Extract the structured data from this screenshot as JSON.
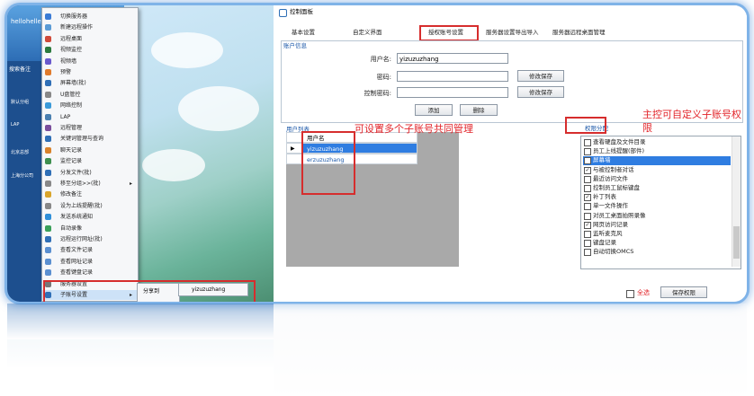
{
  "window": {
    "title": "控制面板"
  },
  "tabs": [
    "基本设置",
    "自定义界面",
    "授权账号设置",
    "服务器设置导出导入",
    "服务器远程桌面管理"
  ],
  "account_info": {
    "section_label": "账户信息",
    "username_label": "用户名:",
    "username_value": "yizuzuzhang",
    "password_label": "密码:",
    "control_password_label": "控制密码:",
    "save_modify_label": "修改保存",
    "add_label": "添加",
    "delete_label": "删除"
  },
  "user_list": {
    "section_label": "用户列表",
    "header": "用户名",
    "rows": [
      "yizuzuzhang",
      "erzuzuzhang"
    ]
  },
  "annotations": {
    "multi_accounts": "可设置多个子账号共同管理",
    "permissions_line1": "主控可自定义子账号权",
    "permissions_line2": "限"
  },
  "permissions": {
    "section_label": "权限分配",
    "items": [
      {
        "label": "查看硬盘及文件目录",
        "checked": false
      },
      {
        "label": "员工上线提醒(部件)",
        "checked": false
      },
      {
        "label": "屏幕墙",
        "checked": true
      },
      {
        "label": "与被控制者对话",
        "checked": true
      },
      {
        "label": "最近访问文件",
        "checked": false
      },
      {
        "label": "控制员工鼠标键盘",
        "checked": false
      },
      {
        "label": "补丁列表",
        "checked": true
      },
      {
        "label": "单一文件操作",
        "checked": false
      },
      {
        "label": "对员工桌面拍照录像",
        "checked": false
      },
      {
        "label": "网页访问记录",
        "checked": true
      },
      {
        "label": "监听麦克风",
        "checked": false
      },
      {
        "label": "键盘记录",
        "checked": false
      },
      {
        "label": "自动切换OMCS",
        "checked": false
      }
    ],
    "select_all_label": "全选",
    "save_label": "保存权限"
  },
  "left_app": {
    "header_user": "hellohelle",
    "search_label": "搜索备注",
    "list_items": [
      "默认分组",
      "LAP",
      "北京总部",
      "上海分公司"
    ]
  },
  "context_menu": {
    "items": [
      "切换服务器",
      "新建远程操作",
      "远程桌面",
      "视频监控",
      "视频墙",
      "预警",
      "屏幕墙(批)",
      "U盘管控",
      "网络控制",
      "LAP",
      "远程管理",
      "关键词管理与查询",
      "聊天记录",
      "监控记录",
      "分发文件(批)",
      "移至分组>>(批)",
      "修改备注",
      "设为上线提醒(批)",
      "发送系统通知",
      "自动录像",
      "远程运行网址(批)",
      "查看文件记录",
      "查看网址记录",
      "查看键盘记录",
      "服务器设置",
      "子账号设置"
    ],
    "submenu_item": "分享到",
    "submenu_target": "yizuzuzhang"
  },
  "colors": {
    "accent": "#2f7de1",
    "annotation": "#e2242a",
    "section": "#1a57a8"
  }
}
